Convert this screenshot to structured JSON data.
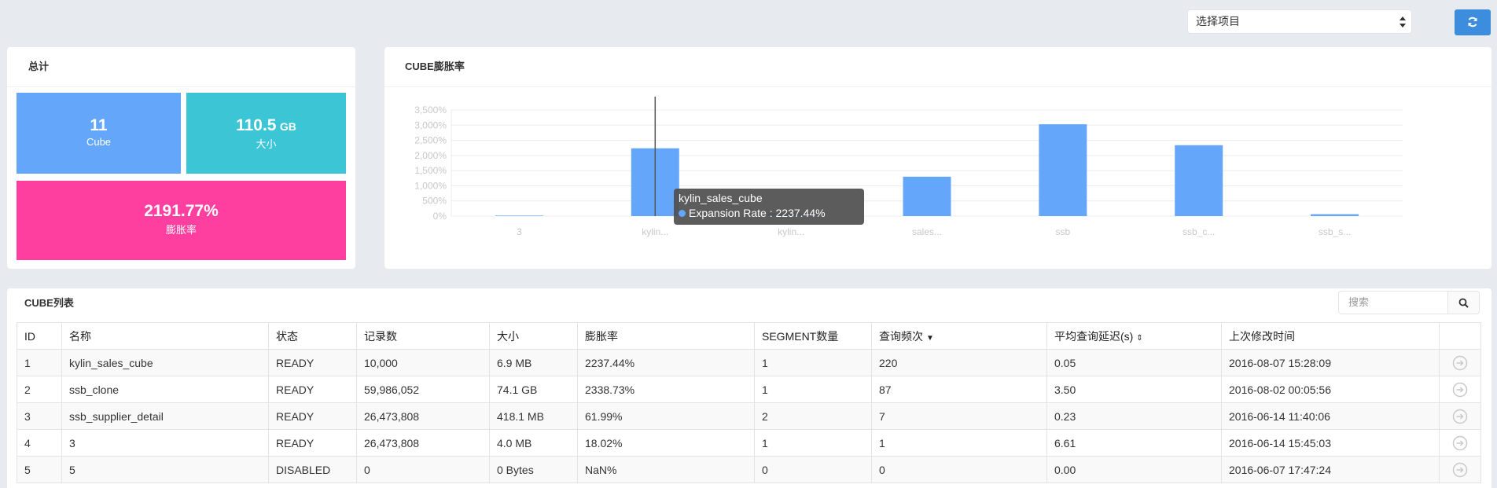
{
  "header": {
    "project_select": "选择项目",
    "colors": {
      "refresh": "#3c8dde"
    }
  },
  "total": {
    "title": "总计",
    "cube_count": "11",
    "cube_label": "Cube",
    "size_value": "110.5",
    "size_unit": "GB",
    "size_label": "大小",
    "expansion_value": "2191.77%",
    "expansion_label": "膨胀率",
    "colors": {
      "cube": "#64a7fa",
      "size": "#3bc5d5",
      "expansion": "#ff3f9f"
    }
  },
  "chart": {
    "title": "CUBE膨胀率",
    "chart_data": {
      "type": "bar",
      "categories": [
        "3",
        "kylin...",
        "kylin...",
        "sales...",
        "ssb",
        "ssb_c...",
        "ssb_s..."
      ],
      "series": [
        {
          "values": [
            18,
            2237.44,
            100,
            1300,
            3030,
            2338.73,
            61.99
          ]
        }
      ],
      "ylim": [
        0,
        3500
      ],
      "yticks": [
        "0%",
        "500%",
        "1,000%",
        "1,500%",
        "2,000%",
        "2,500%",
        "3,000%",
        "3,500%"
      ],
      "grid": true,
      "bar_color": "#64a7fa"
    },
    "tooltip": {
      "title": "kylin_sales_cube",
      "row": "Expansion Rate : 2237.44%"
    }
  },
  "list": {
    "title": "CUBE列表",
    "search_placeholder": "搜索",
    "columns": [
      "ID",
      "名称",
      "状态",
      "记录数",
      "大小",
      "膨胀率",
      "SEGMENT数量",
      "查询频次",
      "平均查询延迟(s)",
      "上次修改时间",
      ""
    ],
    "rows": [
      [
        "1",
        "kylin_sales_cube",
        "READY",
        "10,000",
        "6.9 MB",
        "2237.44%",
        "1",
        "220",
        "0.05",
        "2016-08-07 15:28:09"
      ],
      [
        "2",
        "ssb_clone",
        "READY",
        "59,986,052",
        "74.1 GB",
        "2338.73%",
        "1",
        "87",
        "3.50",
        "2016-08-02 00:05:56"
      ],
      [
        "3",
        "ssb_supplier_detail",
        "READY",
        "26,473,808",
        "418.1 MB",
        "61.99%",
        "2",
        "7",
        "0.23",
        "2016-06-14 11:40:06"
      ],
      [
        "4",
        "3",
        "READY",
        "26,473,808",
        "4.0 MB",
        "18.02%",
        "1",
        "1",
        "6.61",
        "2016-06-14 15:45:03"
      ],
      [
        "5",
        "5",
        "DISABLED",
        "0",
        "0 Bytes",
        "NaN%",
        "0",
        "0",
        "0.00",
        "2016-06-07 17:47:24"
      ]
    ]
  }
}
